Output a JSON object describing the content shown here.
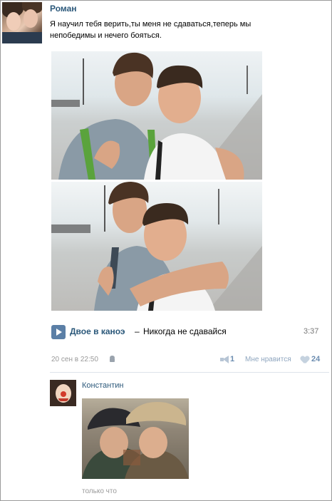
{
  "post": {
    "author": "Роман",
    "text": "Я научил тебя верить,ты меня не сдаваться,теперь мы непобедимы и нечего бояться.",
    "audio": {
      "artist": "Двое в каноэ",
      "separator": "–",
      "title": "Никогда не сдавайся",
      "duration": "3:37"
    },
    "date": "20 сен в 22:50",
    "share_count": "1",
    "like_label": "Мне нравится",
    "like_count": "24"
  },
  "comment": {
    "author": "Константин",
    "time": "только что"
  },
  "icons": {
    "play": "play-icon",
    "android": "android-icon",
    "share": "megaphone-icon",
    "like": "heart-icon"
  },
  "colors": {
    "link": "#2b587a",
    "play_button": "#5b7fa6",
    "meta": "#999999",
    "counter": "#6b8cb0"
  }
}
